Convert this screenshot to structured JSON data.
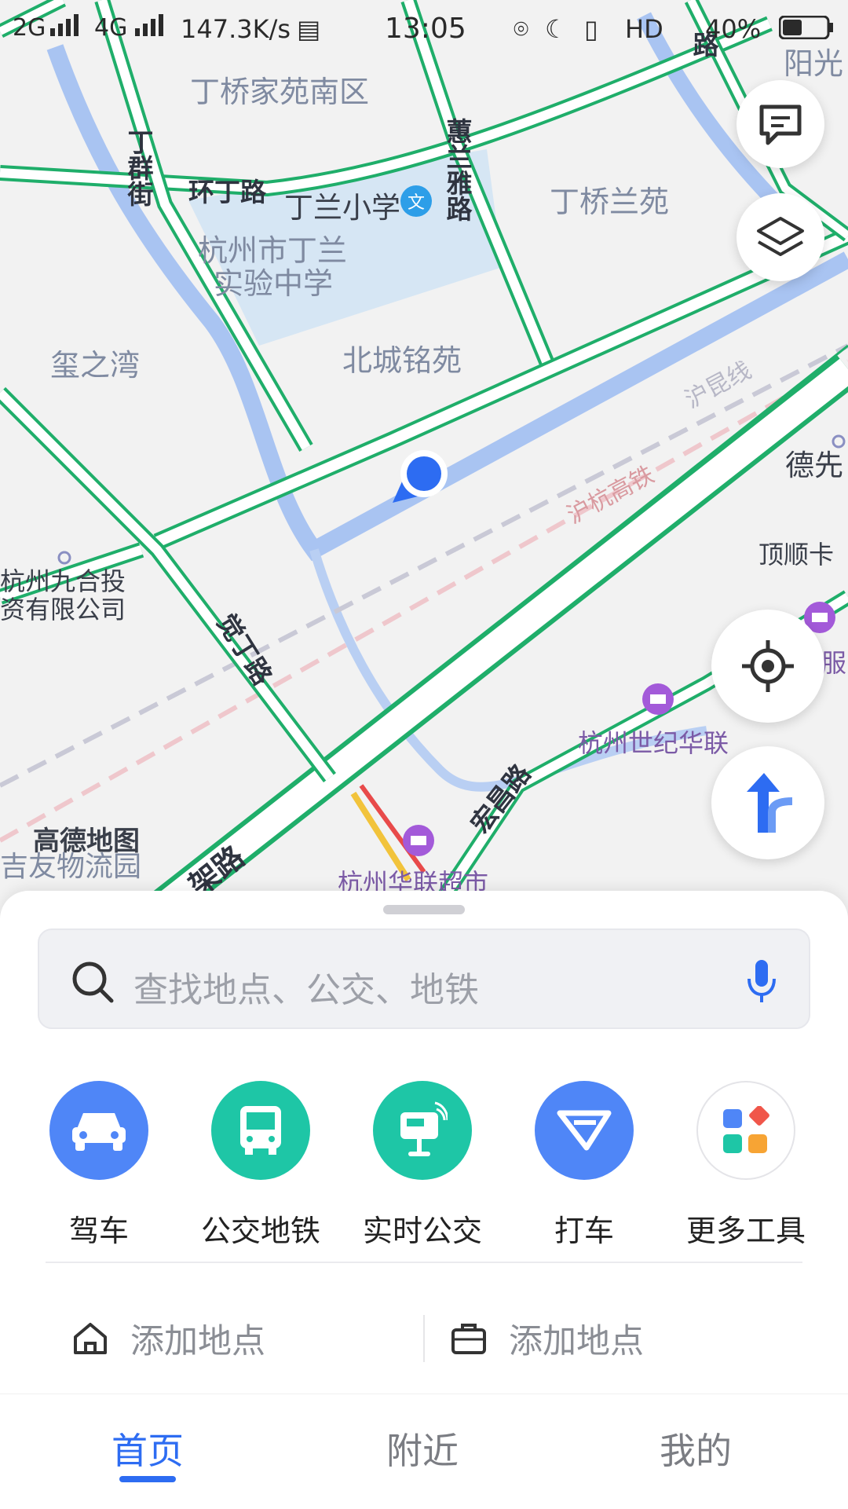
{
  "status_bar": {
    "signal_left": "2G",
    "signal_4g": "4G",
    "net_speed": "147.3K/s",
    "time": "13:05",
    "hd": "HD",
    "battery": "40%"
  },
  "map": {
    "labels": {
      "dingqiao_south": "丁桥家苑南区",
      "huanding_road": "环丁路",
      "dinglan_primary": "丁兰小学",
      "school_line1": "杭州市丁兰",
      "school_line2": "实验中学",
      "xizhiwan": "玺之湾",
      "beicheng": "北城铭苑",
      "dingqiao_lanyuan": "丁桥兰苑",
      "yangguang": "阳光",
      "huilan_road": "蕙兰雅路",
      "dingqun_street": "丁群街",
      "hukun_line": "沪昆线",
      "huhang_hsr": "沪杭高铁",
      "dexian": "德先",
      "dingshun": "顶顺卡",
      "jiuhe_line1": "杭州九合投",
      "jiuhe_line2": "资有限公司",
      "xuanding_road": "觉丁路",
      "century_hualian": "杭州世纪华联",
      "hongchang_road": "宏昌路",
      "service": "服",
      "gaode_logo": "高德地图",
      "jiyou": "吉友物流园",
      "hualian_market": "杭州华联超市",
      "elevated_road": "架路",
      "top_road_right": "路"
    }
  },
  "buttons": {
    "message_icon": "message-icon",
    "layers_icon": "layers-icon",
    "locate_icon": "locate-icon",
    "route_icon": "route-icon"
  },
  "search": {
    "placeholder": "查找地点、公交、地铁"
  },
  "tools": [
    {
      "label": "驾车",
      "icon": "car-icon",
      "color": "#4f86f7"
    },
    {
      "label": "公交地铁",
      "icon": "bus-icon",
      "color": "#1ec6a6"
    },
    {
      "label": "实时公交",
      "icon": "bus-stop-icon",
      "color": "#1ec6a6"
    },
    {
      "label": "打车",
      "icon": "taxi-icon",
      "color": "#4f86f7"
    },
    {
      "label": "更多工具",
      "icon": "grid-icon",
      "color": "#ffffff"
    }
  ],
  "places": {
    "home_label": "添加地点",
    "work_label": "添加地点"
  },
  "nav": {
    "home": "首页",
    "nearby": "附近",
    "mine": "我的"
  },
  "colors": {
    "accent": "#2d6cf2",
    "road_outline": "#1fae6a",
    "river": "#a9c4f2"
  }
}
